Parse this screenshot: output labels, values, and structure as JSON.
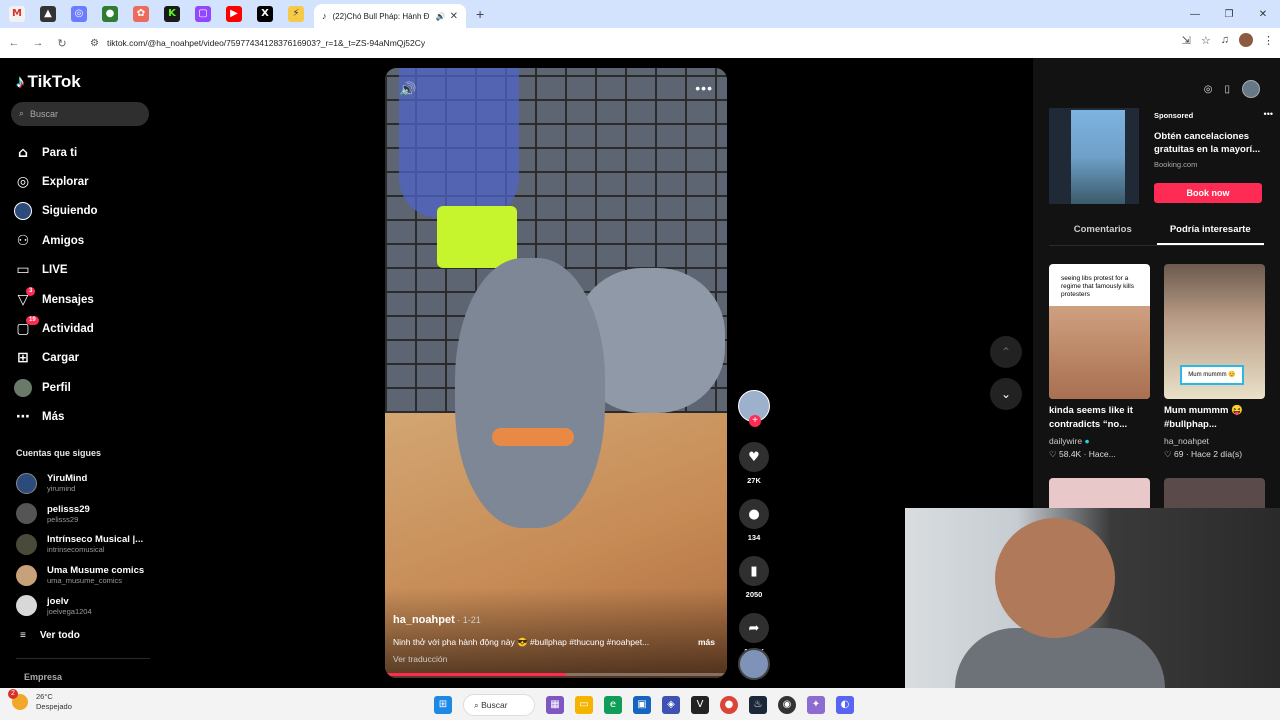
{
  "browser": {
    "active_tab_title": "(22)Chó Bull Pháp: Hành Đ",
    "url": "tiktok.com/@ha_noahpet/video/7597743412837616903?_r=1&_t=ZS-94aNmQj52Cy"
  },
  "sidebar": {
    "logo": "TikTok",
    "search_placeholder": "Buscar",
    "menu": [
      {
        "label": "Para ti",
        "icon": "home-icon"
      },
      {
        "label": "Explorar",
        "icon": "compass-icon"
      },
      {
        "label": "Siguiendo",
        "icon": "following-avatar-icon"
      },
      {
        "label": "Amigos",
        "icon": "friends-icon"
      },
      {
        "label": "LIVE",
        "icon": "live-tv-icon"
      },
      {
        "label": "Mensajes",
        "icon": "send-icon",
        "badge": "3"
      },
      {
        "label": "Actividad",
        "icon": "activity-icon",
        "badge": "19"
      },
      {
        "label": "Cargar",
        "icon": "upload-icon"
      },
      {
        "label": "Perfil",
        "icon": "profile-avatar-icon"
      },
      {
        "label": "Más",
        "icon": "more-dots-icon"
      }
    ],
    "following_title": "Cuentas que sigues",
    "following": [
      {
        "name": "YiruMind",
        "user": "yirumind",
        "color": "#2c4b7a"
      },
      {
        "name": "pelisss29",
        "user": "pelisss29",
        "color": "#555555"
      },
      {
        "name": "Intrínseco Musical |...",
        "user": "intrinsecomusical",
        "color": "#4a4a3a"
      },
      {
        "name": "Uma Musume comics",
        "user": "uma_musume_comics",
        "color": "#c7a17a"
      },
      {
        "name": "joelv",
        "user": "joelvega1204",
        "color": "#d8d8d8"
      }
    ],
    "see_all": "Ver todo",
    "company": "Empresa"
  },
  "video": {
    "author": "ha_noahpet",
    "date": " · 1-21",
    "caption": "Ninh thở với pha hành động này 😎 #bullphap #thucung #noahpet...",
    "more": "más",
    "translate": "Ver traducción",
    "progress": 0.53
  },
  "actions": {
    "likes": "27K",
    "comments": "134",
    "saves": "2050",
    "shares": "19.8K"
  },
  "right_panel": {
    "ad": {
      "sponsored": "Sponsored",
      "text": "Obtén cancelaciones gratuitas en la mayorí...",
      "source": "Booking.com",
      "button": "Book now"
    },
    "tabs": [
      "Comentarios",
      "Podría interesarte"
    ],
    "cards": [
      {
        "caption": "seeing libs protest for a regime that famously kills protesters",
        "title": "kinda seems like it contradicts “no...",
        "user": "dailywire",
        "likes": "58.4K",
        "time": "Hace..."
      },
      {
        "overlay": "Mum mummm 😊",
        "title": "Mum mummm 😝 #bullphap...",
        "user": "ha_noahpet",
        "likes": "69",
        "time": "Hace 2 día(s)"
      }
    ]
  },
  "taskbar": {
    "weather_badge": "2",
    "temp": "26°C",
    "condition": "Despejado",
    "search": "Buscar"
  }
}
